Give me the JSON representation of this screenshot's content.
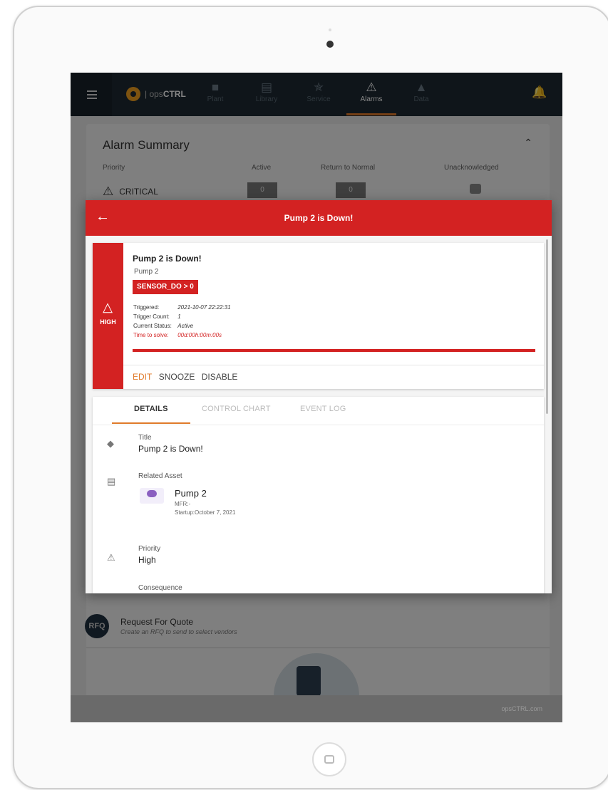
{
  "topbar": {
    "logo_text_prefix": "| ops",
    "logo_text_bold": "CTRL",
    "tabs": [
      {
        "label": "Plant",
        "icon": "factory-icon"
      },
      {
        "label": "Library",
        "icon": "book-icon"
      },
      {
        "label": "Service",
        "icon": "wrench-icon"
      },
      {
        "label": "Alarms",
        "icon": "warning-icon",
        "active": true
      },
      {
        "label": "Data",
        "icon": "area-chart-icon"
      }
    ]
  },
  "summary": {
    "title": "Alarm Summary",
    "columns": [
      "Priority",
      "Active",
      "Return to Normal",
      "Unacknowledged"
    ],
    "rows": [
      {
        "priority": "CRITICAL",
        "active": "0",
        "return_to_normal": "0"
      }
    ]
  },
  "rfq": {
    "badge": "RFQ",
    "title": "Request For Quote",
    "subtitle": "Create an RFQ to send to select vendors"
  },
  "footer": {
    "text": "opsCTRL.com"
  },
  "modal": {
    "title": "Pump 2 is Down!",
    "alarm": {
      "priority": "HIGH",
      "title": "Pump 2 is Down!",
      "asset": "Pump 2",
      "condition": "SENSOR_DO > 0",
      "triggered_label": "Triggered:",
      "triggered_value": "2021-10-07 22:22:31",
      "count_label": "Trigger Count:",
      "count_value": "1",
      "status_label": "Current Status:",
      "status_value": "Active",
      "tts_label": "Time to solve:",
      "tts_value": "00d:00h:00m:00s",
      "actions": {
        "edit": "EDIT",
        "snooze": "SNOOZE",
        "disable": "DISABLE"
      }
    },
    "tabs": [
      "DETAILS",
      "CONTROL CHART",
      "EVENT LOG"
    ],
    "details": {
      "title_label": "Title",
      "title_value": "Pump 2 is Down!",
      "asset_label": "Related Asset",
      "asset_name": "Pump 2",
      "asset_mfr": "MFR:-",
      "asset_startup": "Startup:October 7, 2021",
      "priority_label": "Priority",
      "priority_value": "High",
      "consequence_label": "Consequence"
    }
  },
  "colors": {
    "accent": "#e07a2a",
    "alarm_red": "#d32222",
    "topbar": "#1e2a33"
  }
}
